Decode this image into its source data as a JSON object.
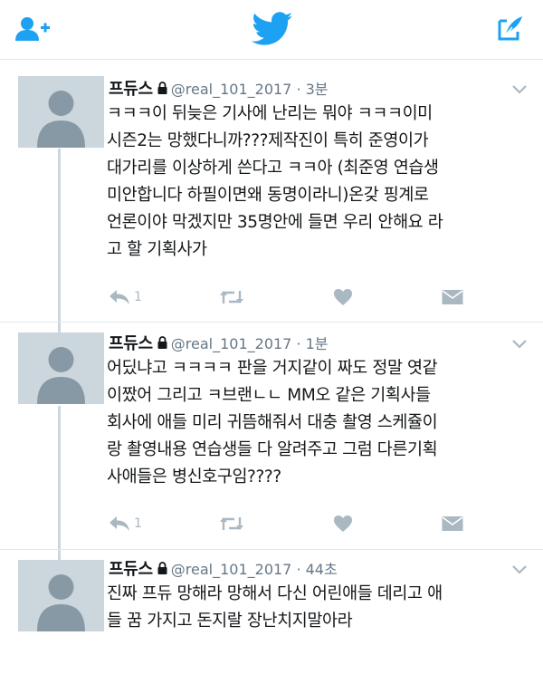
{
  "topbar": {
    "left_icon": "add-user-icon",
    "center_icon": "twitter-bird-icon",
    "right_icon": "compose-icon",
    "accent": "#1da1f2"
  },
  "tweets": [
    {
      "name": "프듀스",
      "handle": "@real_101_2017 · 3분",
      "text": "ㅋㅋㅋ이 뒤늦은 기사에 난리는 뭐야 ㅋㅋㅋ이미\n시즌2는 망했다니까???제작진이 특히 준영이가\n대가리를 이상하게 쓴다고 ㅋㅋ아 (최준영 연습생\n미안합니다 하필이면왜 동명이라니)온갖 핑계로\n언론이야 막겠지만 35명안에 들면 우리 안해요 라\n고 할 기획사가",
      "reply_count": "1"
    },
    {
      "name": "프듀스",
      "handle": "@real_101_2017 · 1분",
      "text": "어딨냐고 ㅋㅋㅋㅋ 판을 거지같이 짜도 정말 엿같\n이짰어 그리고 ㅋ브랜ㄴㄴ MM오 같은 기획사들\n회사에 애들 미리 귀뜸해줘서 대충 촬영 스케쥴이\n랑 촬영내용 연습생들 다 알려주고 그럼 다른기획\n사애들은 병신호구임????",
      "reply_count": "1"
    },
    {
      "name": "프듀스",
      "handle": "@real_101_2017 · 44초",
      "text": "진짜 프듀 망해라 망해서 다신 어린애들 데리고 애\n들 꿈 가지고 돈지랄 장난치지말아라",
      "reply_count": ""
    }
  ]
}
